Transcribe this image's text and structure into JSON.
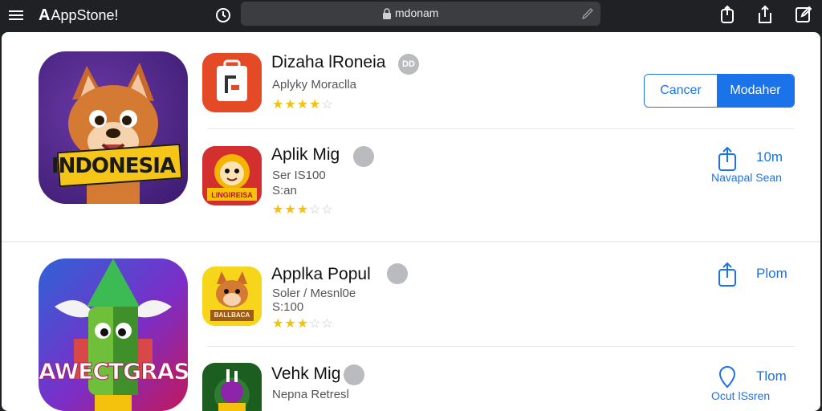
{
  "browser": {
    "logo_letter": "A",
    "logo_text": "AppStone!",
    "url": "mdonam"
  },
  "apps": [
    {
      "title": "Dizaha lRoneia",
      "badge": "DD",
      "subtitle": "Aplyky Moraclla",
      "rating": 4,
      "actions": {
        "cancel": "Cancer",
        "primary": "Modaher"
      }
    },
    {
      "title": "Aplik Mig",
      "badge": "",
      "subtitle_1": "Ser IS100",
      "subtitle_2": "S:an",
      "rating": 3,
      "action_label": "10m",
      "action_sub": "Navapal Sean"
    },
    {
      "title": "Applka Popul",
      "badge": "",
      "subtitle_1": "Soler / Mesnl0e",
      "subtitle_2": "S:100",
      "rating": 3,
      "action_label": "Plom"
    },
    {
      "title": "Vehk Mig",
      "badge": "",
      "subtitle": "Nepna Retresl",
      "action_label": "Tlom",
      "action_sub": "Ocut lSsren"
    }
  ],
  "icons": {
    "app1_icon_text": "",
    "app2_icon_text": "LINGIREISA",
    "app3_icon_text": "BALLBACA"
  },
  "featured": {
    "hero1_text": "INDONESIA",
    "hero2_text": "AWECTGRAS"
  },
  "colors": {
    "accent": "#1a73e8",
    "star": "#f4c20d",
    "chrome": "#202124"
  }
}
